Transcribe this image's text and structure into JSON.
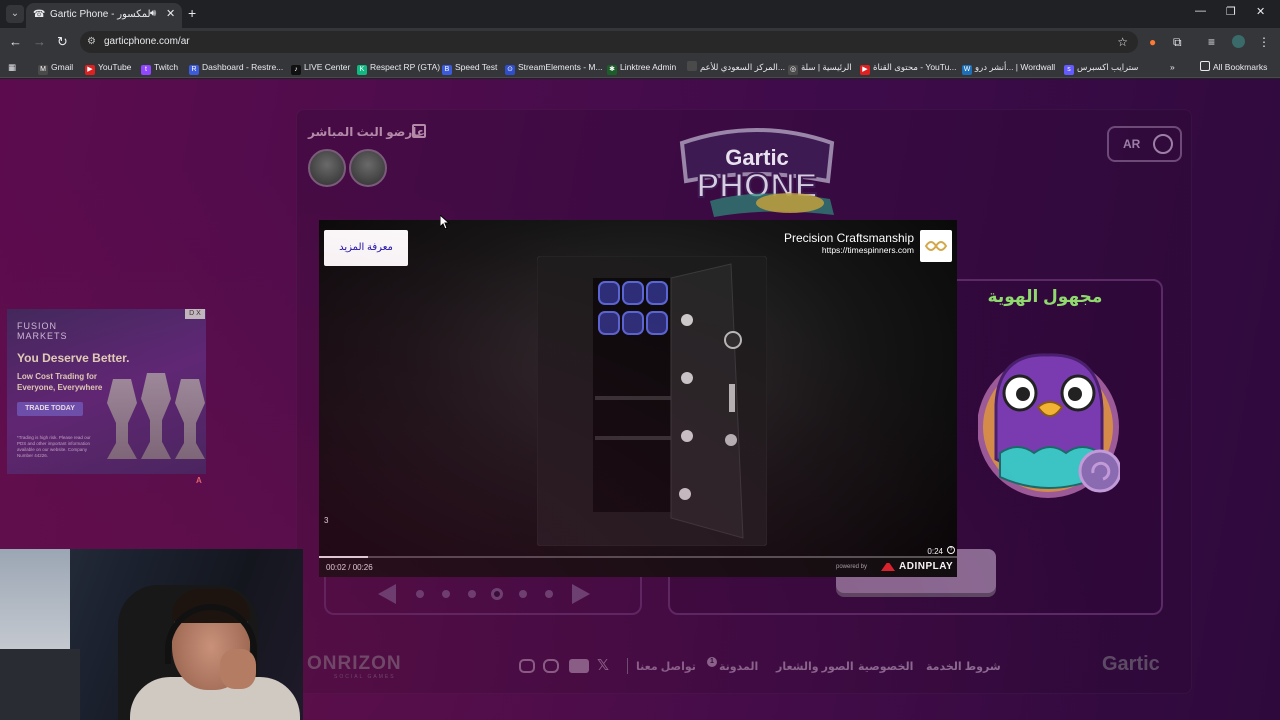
{
  "browser": {
    "tab_title": "Gartic Phone - الهاتف المكسور",
    "url": "garticphone.com/ar",
    "bookmarks": [
      {
        "label": "Gmail",
        "color": "#4a4a4a"
      },
      {
        "label": "YouTube",
        "color": "#e02020"
      },
      {
        "label": "Twitch",
        "color": "#9146ff"
      },
      {
        "label": "Dashboard - Restre...",
        "color": "#3b5bdb"
      },
      {
        "label": "LIVE Center",
        "color": "#111111"
      },
      {
        "label": "Respect RP (GTA)",
        "color": "#10b981"
      },
      {
        "label": "Speed Test",
        "color": "#3b5bdb"
      },
      {
        "label": "StreamElements - M...",
        "color": "#2f4ecb"
      },
      {
        "label": "Linktree Admin",
        "color": "#43e660"
      },
      {
        "label": "المركز السعودي للأعم...",
        "color": "#4a4a4a"
      },
      {
        "label": "الرئيسية | سلة",
        "color": "#4a4a4a"
      },
      {
        "label": "محتوى القناة - YouTu...",
        "color": "#e02020"
      },
      {
        "label": "أنشر درو... | Wordwall",
        "color": "#1d6fb8"
      },
      {
        "label": "سترايب اكسبرس",
        "color": "#635bff"
      }
    ],
    "all_bookmarks": "All Bookmarks"
  },
  "page": {
    "streamers_label": "عارضو البث المباشر",
    "language": "AR",
    "logo_text": "Gartic",
    "logo_sub": "PHONE",
    "profile_name": "مجهول الهوية",
    "footer": {
      "brand": "ONRIZON",
      "brand_sub": "SOCIAL GAMES",
      "links": [
        "شروط الخدمة",
        "الخصوصية",
        "الصور والشعار",
        "المدونة",
        "تواصل معنا"
      ],
      "blog_badge": "1",
      "logo": "Gartic"
    }
  },
  "left_ad": {
    "brand": "FUSION MARKETS",
    "headline": "You Deserve Better.",
    "sub": "Low Cost Trading for Everyone, Everywhere",
    "cta": "TRADE TODAY",
    "corner": "D X",
    "fine_print": "*Trading is high risk. Please read our PDS and other important information available on our website. Company Number 44226.",
    "badge": "A"
  },
  "video_ad": {
    "learn_more": "معرفة المزيد",
    "advertiser_name": "Precision Craftsmanship",
    "advertiser_url": "https://timespinners.com",
    "skip_count": "3",
    "countdown": "0:24",
    "timecode": "00:02 / 00:26",
    "progress": 0.077,
    "powered_by": "powered by",
    "network": "ADINPLAY"
  },
  "colors": {
    "profile_name": "#8fd96e",
    "page_bg": "#4e0c4c"
  }
}
